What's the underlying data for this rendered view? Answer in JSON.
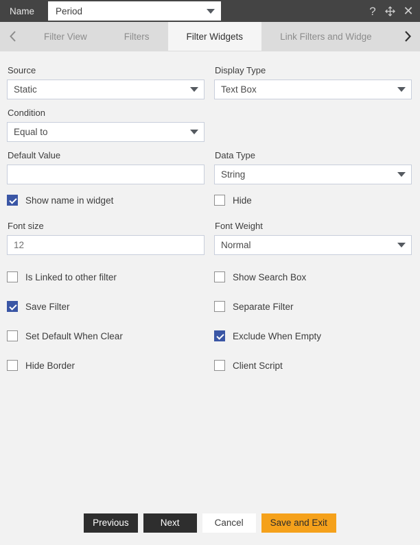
{
  "titlebar": {
    "name_label": "Name",
    "name_value": "Period",
    "caret_icon": "chevron-down-icon",
    "help_icon": "?",
    "move_icon": "move-icon",
    "close_icon": "✕"
  },
  "tabbar": {
    "prev_icon": "chevron-left-icon",
    "next_icon": "chevron-right-icon",
    "tabs": [
      {
        "label": "Filter View",
        "active": false
      },
      {
        "label": "Filters",
        "active": false
      },
      {
        "label": "Filter Widgets",
        "active": true
      },
      {
        "label": "Link Filters and Widge",
        "active": false
      }
    ]
  },
  "form": {
    "source": {
      "label": "Source",
      "value": "Static"
    },
    "display_type": {
      "label": "Display Type",
      "value": "Text Box"
    },
    "condition": {
      "label": "Condition",
      "value": "Equal to"
    },
    "default_value": {
      "label": "Default Value",
      "value": ""
    },
    "data_type": {
      "label": "Data Type",
      "value": "String"
    },
    "font_size": {
      "label": "Font size",
      "value": "12"
    },
    "font_weight": {
      "label": "Font Weight",
      "value": "Normal"
    },
    "toggles": {
      "show_name_in_widget": {
        "label": "Show name in widget",
        "checked": true
      },
      "hide": {
        "label": "Hide",
        "checked": false
      },
      "is_linked_to_other_filter": {
        "label": "Is Linked to other filter",
        "checked": false
      },
      "show_search_box": {
        "label": "Show Search Box",
        "checked": false
      },
      "save_filter": {
        "label": "Save Filter",
        "checked": true
      },
      "separate_filter": {
        "label": "Separate Filter",
        "checked": false
      },
      "set_default_when_clear": {
        "label": "Set Default When Clear",
        "checked": false
      },
      "exclude_when_empty": {
        "label": "Exclude When Empty",
        "checked": true
      },
      "hide_border": {
        "label": "Hide Border",
        "checked": false
      },
      "client_script": {
        "label": "Client Script",
        "checked": false
      }
    }
  },
  "footer": {
    "previous": "Previous",
    "next": "Next",
    "cancel": "Cancel",
    "save_and_exit": "Save and Exit"
  },
  "colors": {
    "titlebar": "#444444",
    "body": "#f2f2f2",
    "tabbar": "#dcdcdc",
    "active_tab": "#f5f5f5",
    "checkbox_checked": "#3a56a5",
    "accent_button": "#f5a11b",
    "dark_button": "#2e2e2e",
    "input_border": "#c8cedb"
  }
}
